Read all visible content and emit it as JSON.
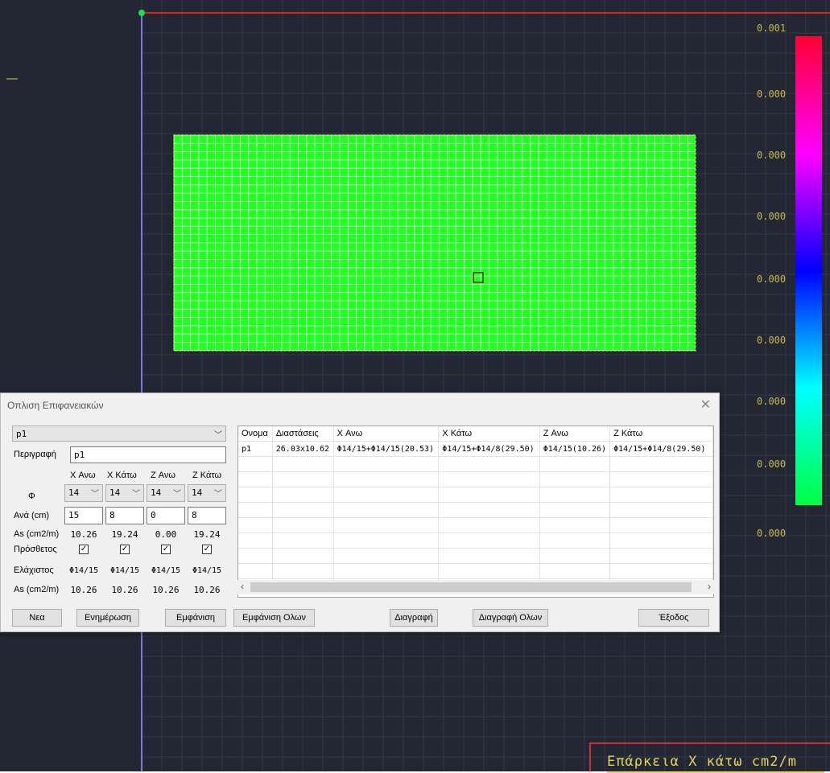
{
  "legend": {
    "labels": [
      "0.001",
      "0.000",
      "0.000",
      "0.000",
      "0.000",
      "0.000",
      "0.000",
      "0.000",
      "0.000"
    ],
    "gradient_colors": [
      "#ff0033",
      "#ff00ff",
      "#0000ff",
      "#00ffff",
      "#00ff44"
    ]
  },
  "caption": "Επάρκεια X κάτω cm2/m",
  "colors": {
    "canvas_bg": "#222733",
    "grid_line": "#323845",
    "mesh_fill": "#22ff22",
    "axis_x": "#dd2222",
    "axis_z": "#7a7adc"
  },
  "dialog": {
    "title": "Οπλιση Επιφανειακών",
    "close_icon": "close-icon",
    "selector": "p1",
    "description_label": "Περιγραφή",
    "description_value": "p1",
    "col_headers": [
      "X Ανω",
      "X Κάτω",
      "Z Ανω",
      "Z Κάτω"
    ],
    "phi_label": "Φ",
    "phi_values": [
      "14",
      "14",
      "14",
      "14"
    ],
    "ana_label": "Ανά (cm)",
    "ana_values": [
      "15",
      "8",
      "0",
      "8"
    ],
    "as_label": "As (cm2/m)",
    "as_values": [
      "10.26",
      "19.24",
      "0.00",
      "19.24"
    ],
    "prosthetos_label": "Πρόσθετος",
    "prosthetos_checked": [
      true,
      true,
      true,
      true
    ],
    "min_label": "Ελάχιστος",
    "min_values": [
      "Φ14/15",
      "Φ14/15",
      "Φ14/15",
      "Φ14/15"
    ],
    "as_min_label": "As (cm2/m)",
    "as_min_values": [
      "10.26",
      "10.26",
      "10.26",
      "10.26"
    ],
    "buttons": {
      "new": "Νεα",
      "update": "Ενημέρωση",
      "show": "Εμφάνιση",
      "show_all": "Εμφάνιση Ολων",
      "delete": "Διαγραφή",
      "delete_all": "Διαγραφή Ολων",
      "exit": "Έξοδος"
    },
    "table": {
      "headers": [
        "Ονομα",
        "Διαστάσεις",
        "X Ανω",
        "X Κάτω",
        "Z Ανω",
        "Z Κάτω"
      ],
      "rows": [
        [
          "p1",
          "26.03x10.62",
          "Φ14/15+Φ14/15(20.53)",
          "Φ14/15+Φ14/8(29.50)",
          "Φ14/15(10.26)",
          "Φ14/15+Φ14/8(29.50)"
        ]
      ]
    }
  }
}
